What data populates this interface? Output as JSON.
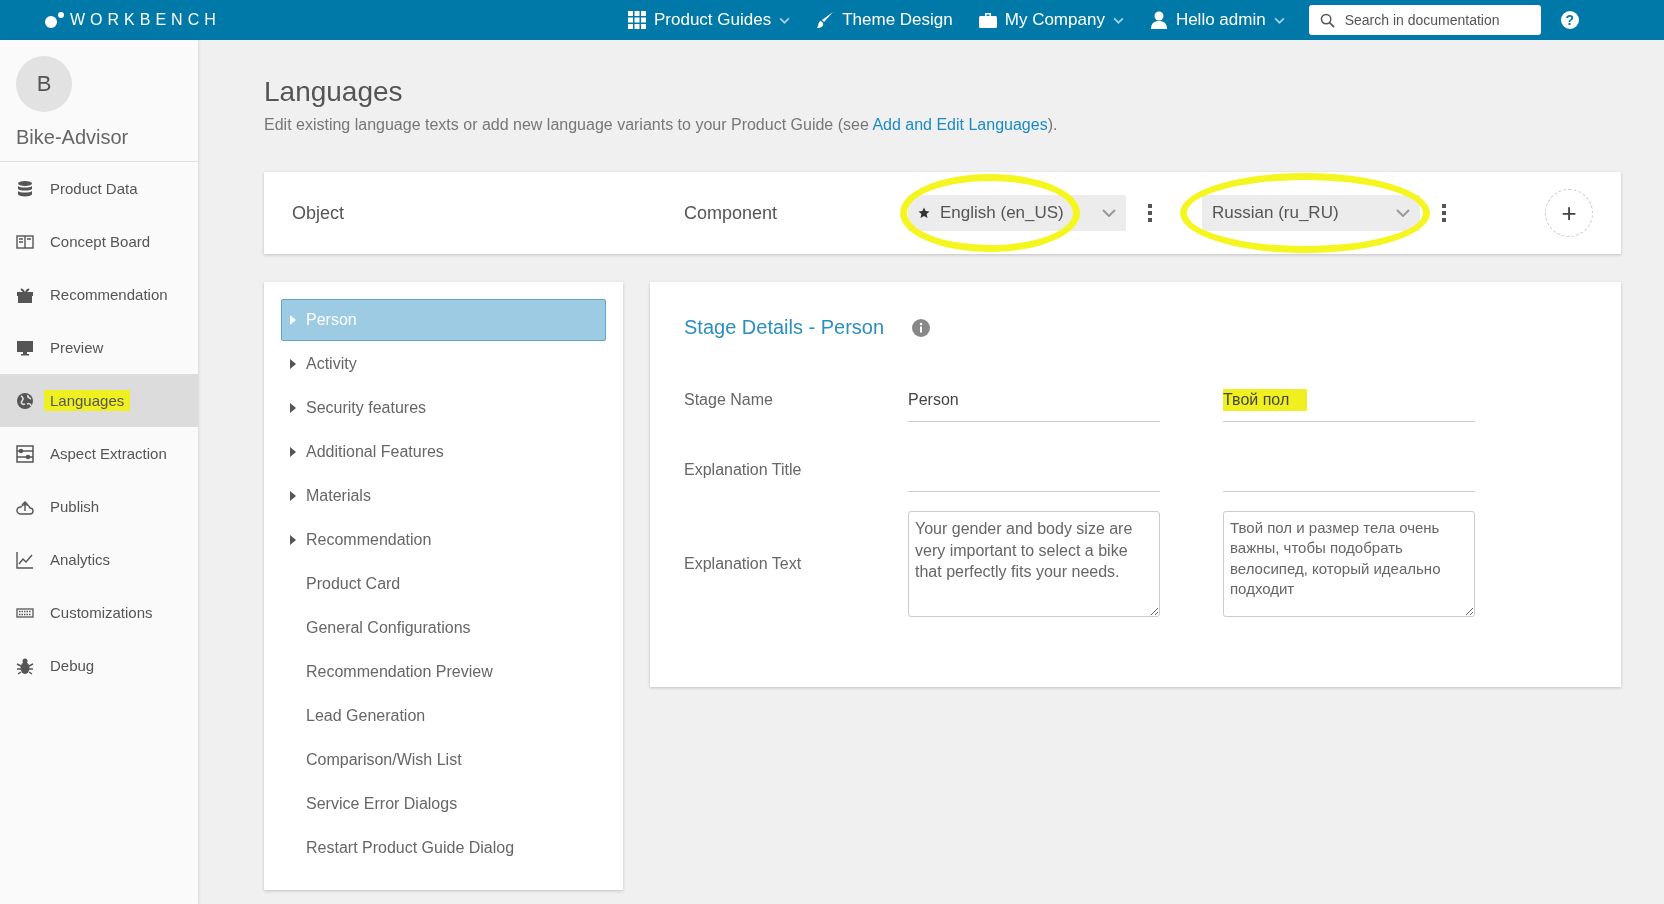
{
  "topbar": {
    "logo": "WORKBENCH",
    "nav": [
      {
        "label": "Product Guides",
        "dropdown": true
      },
      {
        "label": "Theme Design",
        "dropdown": false
      },
      {
        "label": "My Company",
        "dropdown": true
      },
      {
        "label": "Hello admin",
        "dropdown": true
      }
    ],
    "search": {
      "placeholder": "Search in documentation"
    },
    "help": "?"
  },
  "sidebar": {
    "avatar": "B",
    "project": "Bike-Advisor",
    "items": [
      {
        "label": "Product Data",
        "selected": false,
        "highlighted": false
      },
      {
        "label": "Concept Board",
        "selected": false,
        "highlighted": false
      },
      {
        "label": "Recommendation",
        "selected": false,
        "highlighted": false
      },
      {
        "label": "Preview",
        "selected": false,
        "highlighted": false
      },
      {
        "label": "Languages",
        "selected": true,
        "highlighted": true
      },
      {
        "label": "Aspect Extraction",
        "selected": false,
        "highlighted": false
      },
      {
        "label": "Publish",
        "selected": false,
        "highlighted": false
      },
      {
        "label": "Analytics",
        "selected": false,
        "highlighted": false
      },
      {
        "label": "Customizations",
        "selected": false,
        "highlighted": false
      },
      {
        "label": "Debug",
        "selected": false,
        "highlighted": false
      }
    ]
  },
  "page": {
    "title": "Languages",
    "intro_before": "Edit existing language texts or add new language variants to your Product Guide (see ",
    "intro_link": "Add and Edit Languages",
    "intro_after": ")."
  },
  "header": {
    "object": "Object",
    "component": "Component",
    "languages": [
      {
        "label": "English (en_US)",
        "default": true,
        "highlighted": true
      },
      {
        "label": "Russian (ru_RU)",
        "default": false,
        "highlighted": true
      }
    ],
    "add": "+"
  },
  "tree": [
    {
      "label": "Person",
      "expandable": true,
      "selected": true
    },
    {
      "label": "Activity",
      "expandable": true,
      "selected": false
    },
    {
      "label": "Security features",
      "expandable": true,
      "selected": false
    },
    {
      "label": "Additional Features",
      "expandable": true,
      "selected": false
    },
    {
      "label": "Materials",
      "expandable": true,
      "selected": false
    },
    {
      "label": "Recommendation",
      "expandable": true,
      "selected": false
    },
    {
      "label": "Product Card",
      "expandable": false,
      "selected": false
    },
    {
      "label": "General Configurations",
      "expandable": false,
      "selected": false
    },
    {
      "label": "Recommendation Preview",
      "expandable": false,
      "selected": false
    },
    {
      "label": "Lead Generation",
      "expandable": false,
      "selected": false
    },
    {
      "label": "Comparison/Wish List",
      "expandable": false,
      "selected": false
    },
    {
      "label": "Service Error Dialogs",
      "expandable": false,
      "selected": false
    },
    {
      "label": "Restart Product Guide Dialog",
      "expandable": false,
      "selected": false
    }
  ],
  "details": {
    "title": "Stage Details - Person",
    "fields": [
      {
        "label": "Stage Name",
        "kind": "line",
        "values": [
          {
            "text": "Person",
            "highlighted": false
          },
          {
            "text": "Твой пол",
            "highlighted": true
          }
        ]
      },
      {
        "label": "Explanation Title",
        "kind": "blank"
      },
      {
        "label": "Explanation Text",
        "kind": "area",
        "values": [
          {
            "text": "Your gender and body size are very important to select a bike that perfectly fits your needs."
          },
          {
            "text": "Твой пол и размер тела очень важны, чтобы подобрать велосипед, который идеально подходит"
          }
        ]
      }
    ]
  }
}
